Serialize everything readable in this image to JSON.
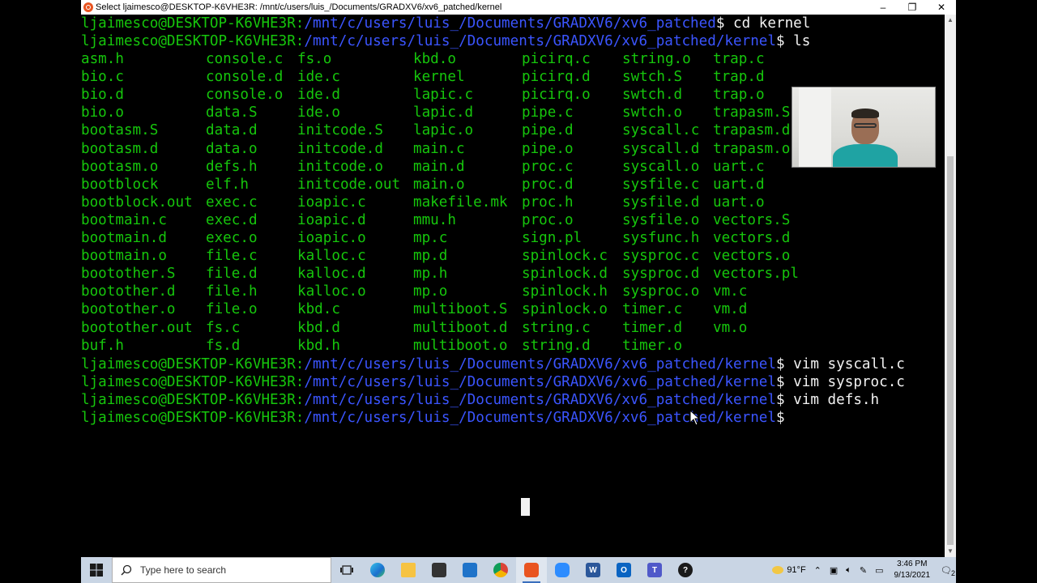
{
  "window": {
    "title": "Select ljaimesco@DESKTOP-K6VHE3R: /mnt/c/users/luis_/Documents/GRADXV6/xv6_patched/kernel",
    "minimize": "–",
    "maximize": "❐",
    "close": "✕"
  },
  "terminal": {
    "prompt_user": "ljaimesco@DESKTOP-K6VHE3R:",
    "prompt_path_root": "/mnt/c/users/luis_/Documents/GRADXV6/xv6_patched",
    "prompt_path_kernel": "/mnt/c/users/luis_/Documents/GRADXV6/xv6_patched/kernel",
    "lines": [
      {
        "path": "/mnt/c/users/luis_/Documents/GRADXV6/xv6_patched",
        "cmd": "$ cd kernel"
      },
      {
        "path": "/mnt/c/users/luis_/Documents/GRADXV6/xv6_patched/kernel",
        "cmd": "$ ls"
      }
    ],
    "ls_columns": [
      [
        "asm.h",
        "bio.c",
        "bio.d",
        "bio.o",
        "bootasm.S",
        "bootasm.d",
        "bootasm.o",
        "bootblock",
        "bootblock.out",
        "bootmain.c",
        "bootmain.d",
        "bootmain.o",
        "bootother.S",
        "bootother.d",
        "bootother.o",
        "bootother.out",
        "buf.h"
      ],
      [
        "console.c",
        "console.d",
        "console.o",
        "data.S",
        "data.d",
        "data.o",
        "defs.h",
        "elf.h",
        "exec.c",
        "exec.d",
        "exec.o",
        "file.c",
        "file.d",
        "file.h",
        "file.o",
        "fs.c",
        "fs.d"
      ],
      [
        "fs.o",
        "ide.c",
        "ide.d",
        "ide.o",
        "initcode.S",
        "initcode.d",
        "initcode.o",
        "initcode.out",
        "ioapic.c",
        "ioapic.d",
        "ioapic.o",
        "kalloc.c",
        "kalloc.d",
        "kalloc.o",
        "kbd.c",
        "kbd.d",
        "kbd.h"
      ],
      [
        "kbd.o",
        "kernel",
        "lapic.c",
        "lapic.d",
        "lapic.o",
        "main.c",
        "main.d",
        "main.o",
        "makefile.mk",
        "mmu.h",
        "mp.c",
        "mp.d",
        "mp.h",
        "mp.o",
        "multiboot.S",
        "multiboot.d",
        "multiboot.o"
      ],
      [
        "picirq.c",
        "picirq.d",
        "picirq.o",
        "pipe.c",
        "pipe.d",
        "pipe.o",
        "proc.c",
        "proc.d",
        "proc.h",
        "proc.o",
        "sign.pl",
        "spinlock.c",
        "spinlock.d",
        "spinlock.h",
        "spinlock.o",
        "string.c",
        "string.d"
      ],
      [
        "string.o",
        "swtch.S",
        "swtch.d",
        "swtch.o",
        "syscall.c",
        "syscall.d",
        "syscall.o",
        "sysfile.c",
        "sysfile.d",
        "sysfile.o",
        "sysfunc.h",
        "sysproc.c",
        "sysproc.d",
        "sysproc.o",
        "timer.c",
        "timer.d",
        "timer.o"
      ],
      [
        "trap.c",
        "trap.d",
        "trap.o",
        "trapasm.S",
        "trapasm.d",
        "trapasm.o",
        "uart.c",
        "uart.d",
        "uart.o",
        "vectors.S",
        "vectors.d",
        "vectors.o",
        "vectors.pl",
        "vm.c",
        "vm.d",
        "vm.o",
        ""
      ]
    ],
    "after_lines": [
      {
        "cmd": "$ vim syscall.c"
      },
      {
        "cmd": "$ vim sysproc.c"
      },
      {
        "cmd": "$ vim defs.h"
      },
      {
        "cmd": "$"
      }
    ]
  },
  "taskbar": {
    "search_placeholder": "Type here to search",
    "weather": "91°F",
    "time": "3:46 PM",
    "date": "9/13/2021",
    "notification_count": "2"
  },
  "colors": {
    "user_green": "#16c60c",
    "path_blue": "#3b55ff",
    "background": "#000000",
    "taskbar": "#c9d5e4"
  }
}
